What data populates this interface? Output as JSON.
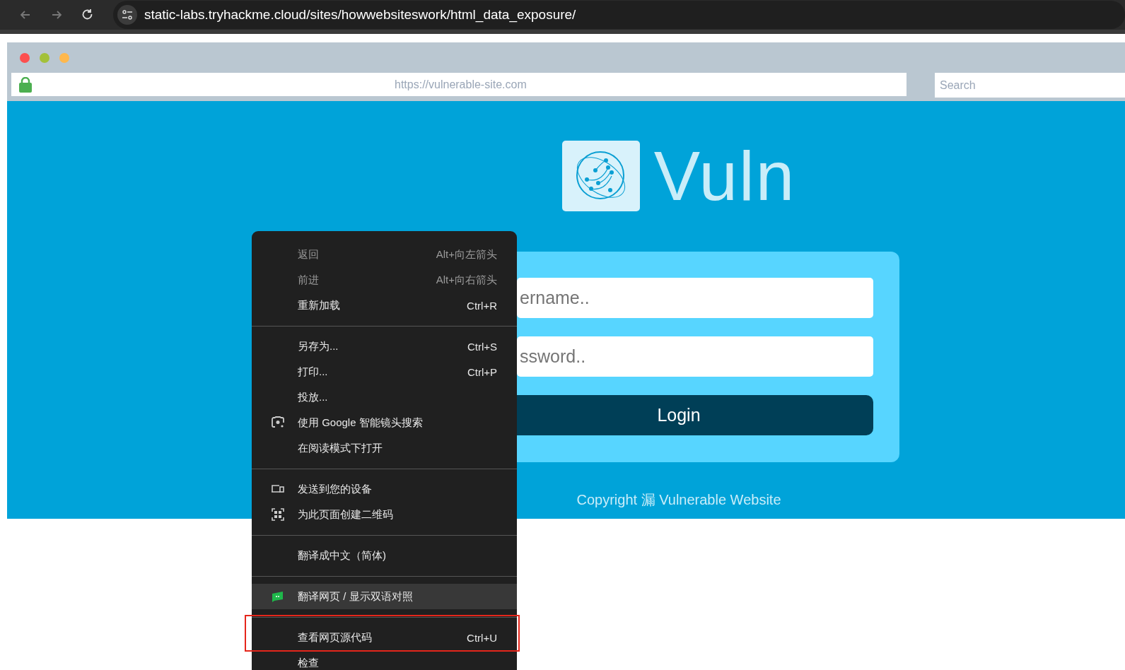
{
  "browser": {
    "url": "static-labs.tryhackme.cloud/sites/howwebsiteswork/html_data_exposure/"
  },
  "mock_browser": {
    "address": "https://vulnerable-site.com",
    "search": {
      "placeholder": "Search"
    }
  },
  "page": {
    "logo_text": "Vuln",
    "username": {
      "placeholder": "ername.."
    },
    "password": {
      "placeholder": "ssword.."
    },
    "login_button": "Login",
    "footer": "Copyright 漏 Vulnerable Website"
  },
  "context_menu": [
    {
      "kind": "item",
      "label": "返回",
      "shortcut": "Alt+向左箭头",
      "disabled": true,
      "highlighted": false
    },
    {
      "kind": "item",
      "label": "前进",
      "shortcut": "Alt+向右箭头",
      "disabled": true,
      "highlighted": false
    },
    {
      "kind": "item",
      "label": "重新加载",
      "shortcut": "Ctrl+R",
      "disabled": false,
      "highlighted": false
    },
    {
      "kind": "separator"
    },
    {
      "kind": "item",
      "label": "另存为...",
      "shortcut": "Ctrl+S",
      "disabled": false,
      "highlighted": false
    },
    {
      "kind": "item",
      "label": "打印...",
      "shortcut": "Ctrl+P",
      "disabled": false,
      "highlighted": false
    },
    {
      "kind": "item",
      "label": "投放...",
      "disabled": false,
      "highlighted": false
    },
    {
      "kind": "lens",
      "label": "使用 Google 智能镜头搜索",
      "disabled": false,
      "highlighted": false
    },
    {
      "kind": "item",
      "label": "在阅读模式下打开",
      "disabled": false,
      "highlighted": false
    },
    {
      "kind": "separator"
    },
    {
      "kind": "device",
      "label": "发送到您的设备",
      "disabled": false,
      "highlighted": false
    },
    {
      "kind": "qr",
      "label": "为此页面创建二维码",
      "disabled": false,
      "highlighted": false
    },
    {
      "kind": "separator"
    },
    {
      "kind": "item",
      "label": "翻译成中文（简体)",
      "disabled": false,
      "highlighted": false
    },
    {
      "kind": "separator"
    },
    {
      "kind": "extension",
      "label": "翻译网页 / 显示双语对照",
      "disabled": false,
      "highlighted": true
    },
    {
      "kind": "separator"
    },
    {
      "kind": "item",
      "label": "查看网页源代码",
      "shortcut": "Ctrl+U",
      "disabled": false,
      "highlighted": false,
      "outlined": true
    },
    {
      "kind": "item",
      "label": "检查",
      "disabled": false,
      "highlighted": false
    }
  ]
}
